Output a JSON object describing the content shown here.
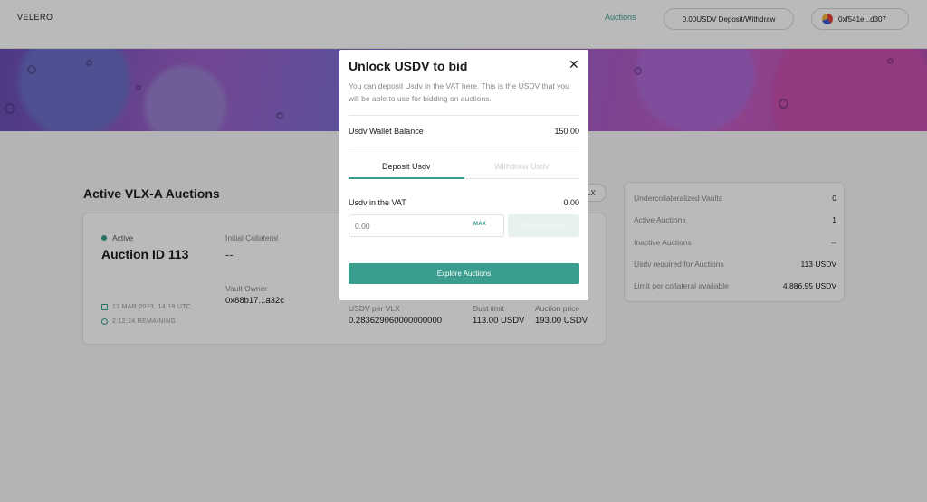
{
  "header": {
    "logo": "VELERO",
    "nav_auctions": "Auctions",
    "deposit_button": "0.00USDV Deposit/Withdraw",
    "wallet_address": "0xf541e...d307"
  },
  "section": {
    "title": "Active VLX-A Auctions",
    "button_partial": "LX"
  },
  "auction": {
    "status": "Active",
    "id": "Auction ID 113",
    "initial_collateral_label": "Initial Collateral",
    "initial_collateral_value": "--",
    "vault_owner_label": "Vault Owner",
    "vault_owner_value": "0x88b17...a32c",
    "date": "13 MAR 2023, 14:18 UTC",
    "remaining": "2:12:24 REMAINING",
    "usdv_per_vlx_label": "USDV per VLX",
    "usdv_per_vlx_value": "0.283629060000000000",
    "dust_limit_label": "Dust limit",
    "dust_limit_value": "113.00 USDV",
    "auction_price_label": "Auction price",
    "auction_price_value": "193.00 USDV"
  },
  "stats": [
    {
      "label": "Undercollateralized Vaults",
      "value": "0"
    },
    {
      "label": "Active Auctions",
      "value": "1"
    },
    {
      "label": "Inactive Auctions",
      "value": "--"
    },
    {
      "label": "Usdv required for Auctions",
      "value": "113 USDV"
    },
    {
      "label": "Limit per collateral available",
      "value": "4,886.95 USDV"
    }
  ],
  "modal": {
    "title": "Unlock USDV to bid",
    "close": "✕",
    "description": "You can deposit Usdv in the VAT here. This is the USDV that you will be able to use for bidding on auctions.",
    "wallet_balance_label": "Usdv Wallet Balance",
    "wallet_balance_value": "150.00",
    "tab_deposit": "Deposit Usdv",
    "tab_withdraw": "Withdraw Usdv",
    "vat_label": "Usdv in the VAT",
    "vat_value": "0.00",
    "input_placeholder": "0.00",
    "max_label": "MAX",
    "deposit_button": "Deposit Usdv",
    "explore_button": "Explore Auctions"
  },
  "colors": {
    "accent": "#3a9d8d",
    "overlay": "rgba(0,0,0,0.27)"
  }
}
